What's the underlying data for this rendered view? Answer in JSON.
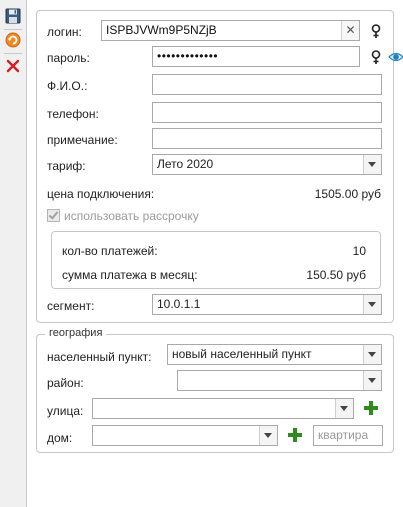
{
  "toolbar": {
    "save_icon": "floppy-disk-icon",
    "refresh_icon": "refresh-icon",
    "cancel_icon": "red-x-icon"
  },
  "form": {
    "login_label": "логин:",
    "login_value": "ISPBJVWm9P5NZjB",
    "password_label": "пароль:",
    "password_value": "•••••••••••••",
    "fio_label": "Ф.И.О.:",
    "fio_value": "",
    "phone_label": "телефон:",
    "phone_value": "",
    "note_label": "примечание:",
    "note_value": "",
    "tariff_label": "тариф:",
    "tariff_value": "Лето 2020",
    "connection_price_label": "цена подключения:",
    "connection_price_value": "1505.00 руб",
    "installment_label": "использовать рассрочку",
    "installment_checked": true,
    "payments_count_label": "кол-во платежей:",
    "payments_count_value": "10",
    "monthly_payment_label": "сумма платежа в месяц:",
    "monthly_payment_value": "150.50 руб",
    "segment_label": "сегмент:",
    "segment_value": "10.0.1.1"
  },
  "geo": {
    "legend": "география",
    "locality_label": "населенный пункт:",
    "locality_value": "новый населенный пункт",
    "district_label": "район:",
    "district_value": "",
    "street_label": "улица:",
    "street_value": "",
    "house_label": "дом:",
    "house_value": "",
    "apartment_placeholder": "квартира"
  },
  "colors": {
    "accent_green": "#2e8b1e",
    "eye_blue": "#1e7fbf",
    "cancel_red": "#d22020"
  }
}
